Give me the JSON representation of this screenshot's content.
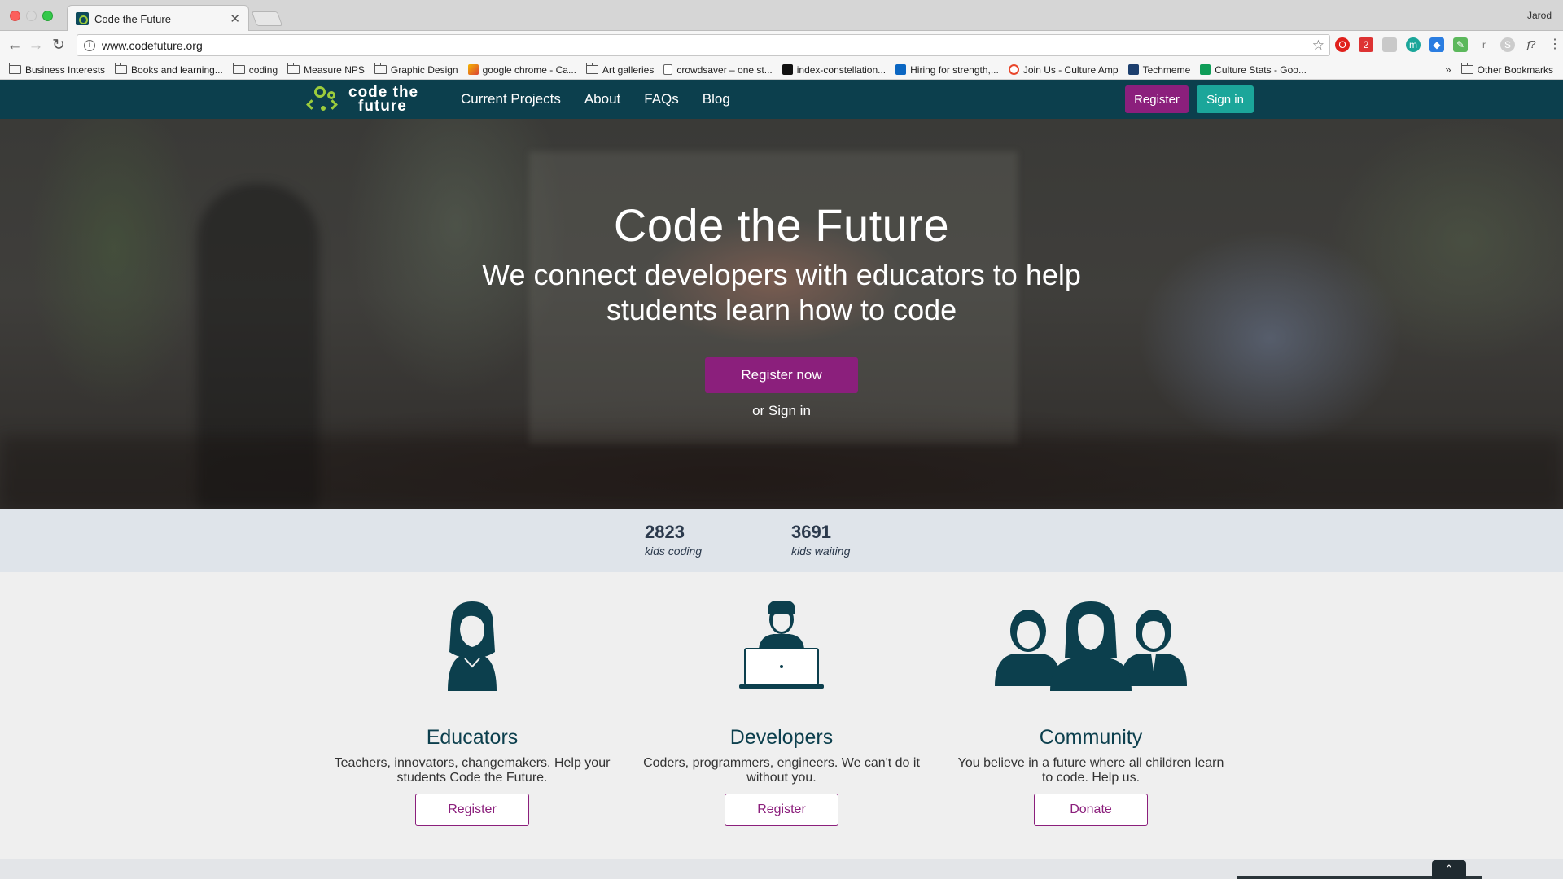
{
  "browser": {
    "tab_title": "Code the Future",
    "profile_name": "Jarod",
    "url": "www.codefuture.org",
    "bookmarks": [
      {
        "label": "Business Interests",
        "icon": "folder-icon"
      },
      {
        "label": "Books and learning...",
        "icon": "folder-icon"
      },
      {
        "label": "coding",
        "icon": "folder-icon"
      },
      {
        "label": "Measure NPS",
        "icon": "folder-icon"
      },
      {
        "label": "Graphic Design",
        "icon": "folder-icon"
      },
      {
        "label": "google chrome - Ca...",
        "icon": "tool-icon"
      },
      {
        "label": "Art galleries",
        "icon": "folder-icon"
      },
      {
        "label": "crowdsaver – one st...",
        "icon": "page-icon"
      },
      {
        "label": "index-constellation...",
        "icon": "black-square-icon"
      },
      {
        "label": "Hiring for strength,...",
        "icon": "linkedin-icon"
      },
      {
        "label": "Join Us - Culture Amp",
        "icon": "culture-amp-icon"
      },
      {
        "label": "Techmeme",
        "icon": "techmeme-icon"
      },
      {
        "label": "Culture Stats - Goo...",
        "icon": "sheets-icon"
      }
    ],
    "more_chevron": "»",
    "other_bookmarks": "Other Bookmarks"
  },
  "nav": {
    "logo_line1": "code the",
    "logo_line2": "future",
    "links": [
      "Current Projects",
      "About",
      "FAQs",
      "Blog"
    ],
    "register": "Register",
    "signin": "Sign in"
  },
  "hero": {
    "title": "Code the Future",
    "subtitle": "We connect developers with educators to help students learn how to code",
    "cta": "Register now",
    "signin_text": "or Sign in"
  },
  "stats": [
    {
      "value": "2823",
      "label": "kids coding"
    },
    {
      "value": "3691",
      "label": "kids waiting"
    }
  ],
  "cards": [
    {
      "title": "Educators",
      "text": "Teachers, innovators, changemakers. Help your students Code the Future.",
      "button": "Register"
    },
    {
      "title": "Developers",
      "text": "Coders, programmers, engineers. We can't do it without you.",
      "button": "Register"
    },
    {
      "title": "Community",
      "text": "You believe in a future where all children learn to code. Help us.",
      "button": "Donate"
    }
  ],
  "colors": {
    "nav_bg": "#0c3f4d",
    "brand_purple": "#8b1f7c",
    "brand_teal": "#1ba69a",
    "logo_green": "#9ccc3c"
  }
}
